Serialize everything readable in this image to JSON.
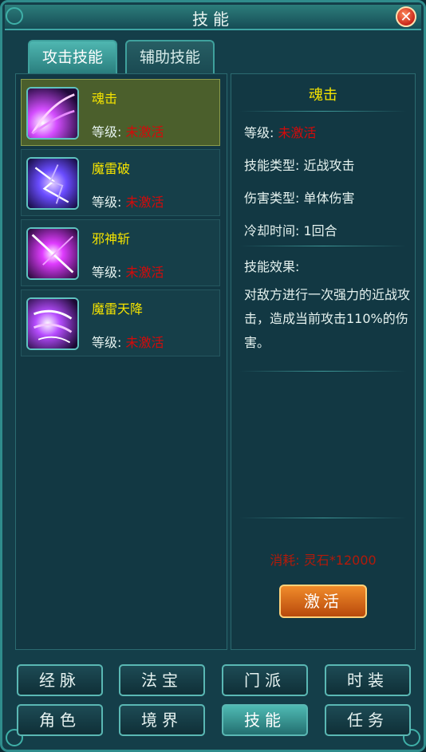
{
  "window": {
    "title": "技能",
    "close_label": "✕"
  },
  "tabs": [
    {
      "label": "攻击技能",
      "active": true
    },
    {
      "label": "辅助技能",
      "active": false
    }
  ],
  "skills": [
    {
      "name": "魂击",
      "level_label": "等级:",
      "level_value": "未激活",
      "selected": true
    },
    {
      "name": "魔雷破",
      "level_label": "等级:",
      "level_value": "未激活",
      "selected": false
    },
    {
      "name": "邪神斩",
      "level_label": "等级:",
      "level_value": "未激活",
      "selected": false
    },
    {
      "name": "魔雷天降",
      "level_label": "等级:",
      "level_value": "未激活",
      "selected": false
    }
  ],
  "detail": {
    "name": "魂击",
    "level_label": "等级:",
    "level_value": "未激活",
    "skill_type": "技能类型: 近战攻击",
    "damage_type": "伤害类型: 单体伤害",
    "cooldown": "冷却时间: 1回合",
    "effect_label": "技能效果:",
    "effect_desc": "对敌方进行一次强力的近战攻击，造成当前攻击110%的伤害。",
    "cost": "消耗: 灵石*12000",
    "activate_label": "激活"
  },
  "bottom_nav": [
    {
      "label": "经脉",
      "active": false
    },
    {
      "label": "法宝",
      "active": false
    },
    {
      "label": "门派",
      "active": false
    },
    {
      "label": "时装",
      "active": false
    },
    {
      "label": "角色",
      "active": false
    },
    {
      "label": "境界",
      "active": false
    },
    {
      "label": "技能",
      "active": true
    },
    {
      "label": "任务",
      "active": false
    }
  ],
  "colors": {
    "skill_name": "#f4e300",
    "inactive": "#d40a0a",
    "cost": "#b31a0a"
  }
}
